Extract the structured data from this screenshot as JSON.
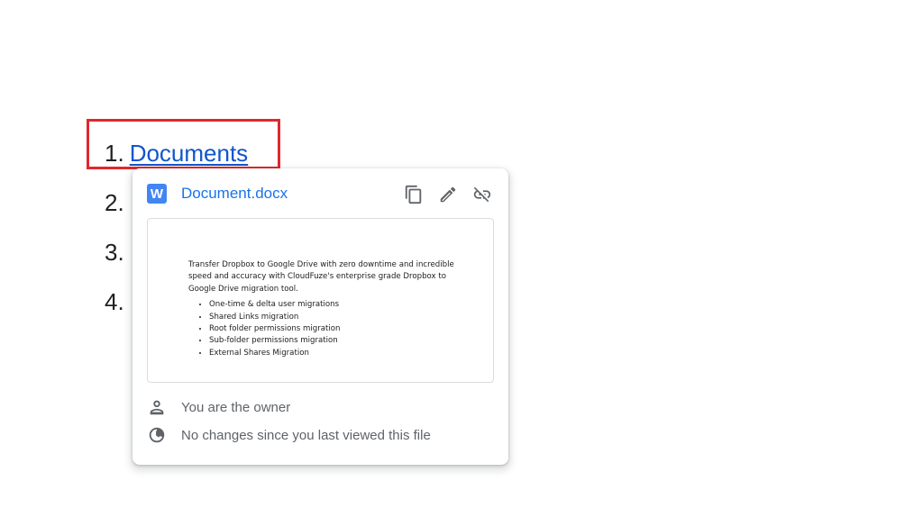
{
  "list": {
    "items": [
      {
        "number": "1.",
        "link_text": "Documents"
      },
      {
        "number": "2."
      },
      {
        "number": "3."
      },
      {
        "number": "4."
      }
    ]
  },
  "link_card": {
    "file_icon_letter": "W",
    "file_name": "Document.docx",
    "actions": {
      "copy_icon": "copy-icon",
      "edit_icon": "pencil-icon",
      "unlink_icon": "unlink-icon"
    },
    "preview": {
      "paragraph": "Transfer Dropbox to Google Drive with zero downtime and incredible speed and accuracy with CloudFuze's enterprise grade Dropbox to Google Drive migration tool.",
      "bullets": [
        "One-time & delta user migrations",
        "Shared Links migration",
        "Root folder permissions migration",
        "Sub-folder permissions migration",
        "External Shares Migration"
      ]
    },
    "owner_text": "You are the owner",
    "changes_text": "No changes since you last viewed this file"
  },
  "colors": {
    "link": "#1155cc",
    "highlight": "#e0282e",
    "word_icon": "#4285f4",
    "file_name": "#1a73e8",
    "secondary_text": "#5f6368"
  }
}
